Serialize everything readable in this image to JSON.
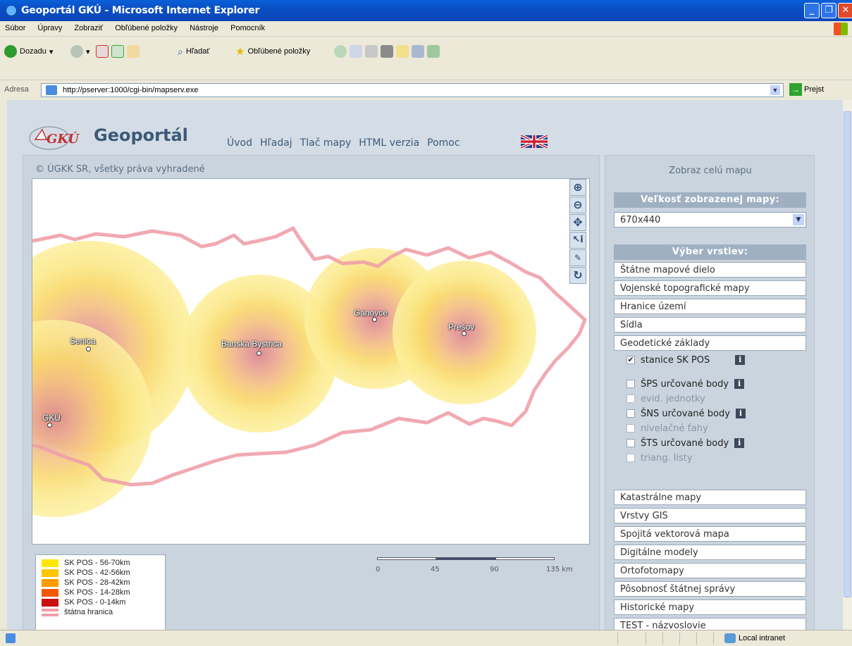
{
  "window": {
    "title": "Geoportál GKÚ - Microsoft Internet Explorer"
  },
  "menu": {
    "items": [
      "Súbor",
      "Úpravy",
      "Zobraziť",
      "Obľúbené položky",
      "Nástroje",
      "Pomocník"
    ]
  },
  "toolbar": {
    "back_label": "Dozadu",
    "search_label": "Hľadať",
    "favorites_label": "Obľúbené položky"
  },
  "address": {
    "label": "Adresa",
    "url": "http://pserver:1000/cgi-bin/mapserv.exe",
    "go_label": "Prejst"
  },
  "status": {
    "zone": "Local intranet"
  },
  "header": {
    "logo_text": "GKÚ",
    "brand": "Geoportál",
    "nav": [
      "Úvod",
      "Hľadaj",
      "Tlač mapy",
      "HTML verzia",
      "Pomoc"
    ]
  },
  "map": {
    "copyright": "© ÚGKK SR, všetky práva vyhradené",
    "cities": [
      "Senica",
      "Banská Bystrica",
      "Gánovce",
      "Prešov",
      "GKÚ"
    ]
  },
  "legend": {
    "items": [
      {
        "label": "SK POS - 56-70km",
        "color": "#ffe600"
      },
      {
        "label": "SK POS - 42-56km",
        "color": "#ffc600"
      },
      {
        "label": "SK POS - 28-42km",
        "color": "#ff9a00"
      },
      {
        "label": "SK POS - 14-28km",
        "color": "#f25a00"
      },
      {
        "label": "SK POS - 0-14km",
        "color": "#c81010"
      },
      {
        "label": "štátna hranica",
        "color": "#f0a0a8"
      }
    ]
  },
  "scalebar": {
    "labels": [
      "0",
      "45",
      "90",
      "135 km"
    ]
  },
  "side": {
    "full_map": "Zobraz celú mapu",
    "size_header": "Veľkosť zobrazenej mapy:",
    "size_value": "670x440",
    "layers_header": "Výber vrstiev:",
    "layers_top": [
      "Štátne mapové dielo",
      "Vojenské topografické mapy",
      "Hranice území",
      "Sídla",
      "Geodetické základy"
    ],
    "sublayers": [
      {
        "label": "stanice SK POS",
        "checked": "✔"
      },
      {
        "label": "ŠPS určované body",
        "checked": ""
      },
      {
        "label": "evid. jednotky",
        "checked": ""
      },
      {
        "label": "ŠNS určované body",
        "checked": ""
      },
      {
        "label": "nivelačné ťahy",
        "checked": ""
      },
      {
        "label": "ŠTS určované body",
        "checked": ""
      },
      {
        "label": "triang. listy",
        "checked": ""
      }
    ],
    "layers_bottom": [
      "Katastrálne mapy",
      "Vrstvy GIS",
      "Spojitá vektorová mapa",
      "Digitálne modely",
      "Ortofotomapy",
      "Pôsobnosť štátnej správy",
      "Historické mapy",
      "TEST - názvoslovie"
    ]
  }
}
